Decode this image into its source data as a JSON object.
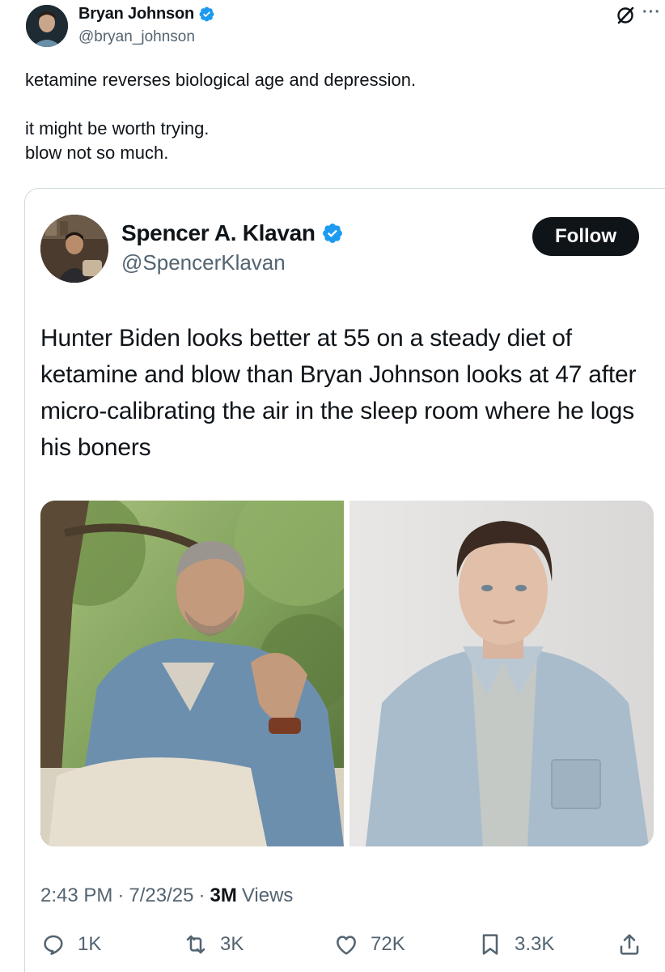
{
  "post": {
    "author_name": "Bryan Johnson",
    "author_handle": "@bryan_johnson",
    "text_line1": "ketamine reverses biological age and depression.",
    "text_line2": "it might be worth trying.",
    "text_line3": "blow not so much."
  },
  "quoted": {
    "author_name": "Spencer A. Klavan",
    "author_handle": "@SpencerKlavan",
    "follow_label": "Follow",
    "text": "Hunter Biden looks better at 55 on a steady diet of ketamine and blow than Bryan Johnson looks at 47 after micro-calibrating the air in the sleep room where he logs his boners",
    "time": "2:43 PM",
    "sep1": "·",
    "date": "7/23/25",
    "sep2": "·",
    "views_count": "3M",
    "views_label": "Views"
  },
  "actions": {
    "replies": "1K",
    "reposts": "3K",
    "likes": "72K",
    "bookmarks": "3.3K"
  },
  "icons": {
    "verified": "verified-badge-icon",
    "grok": "grok-icon",
    "more": "more-icon",
    "reply": "reply-icon",
    "repost": "repost-icon",
    "like": "heart-icon",
    "bookmark": "bookmark-icon",
    "share": "share-icon"
  },
  "colors": {
    "verified_blue": "#1d9bf0",
    "text_primary": "#0f1419",
    "text_secondary": "#536471",
    "border": "#cfd9de",
    "follow_bg": "#0f1419"
  }
}
